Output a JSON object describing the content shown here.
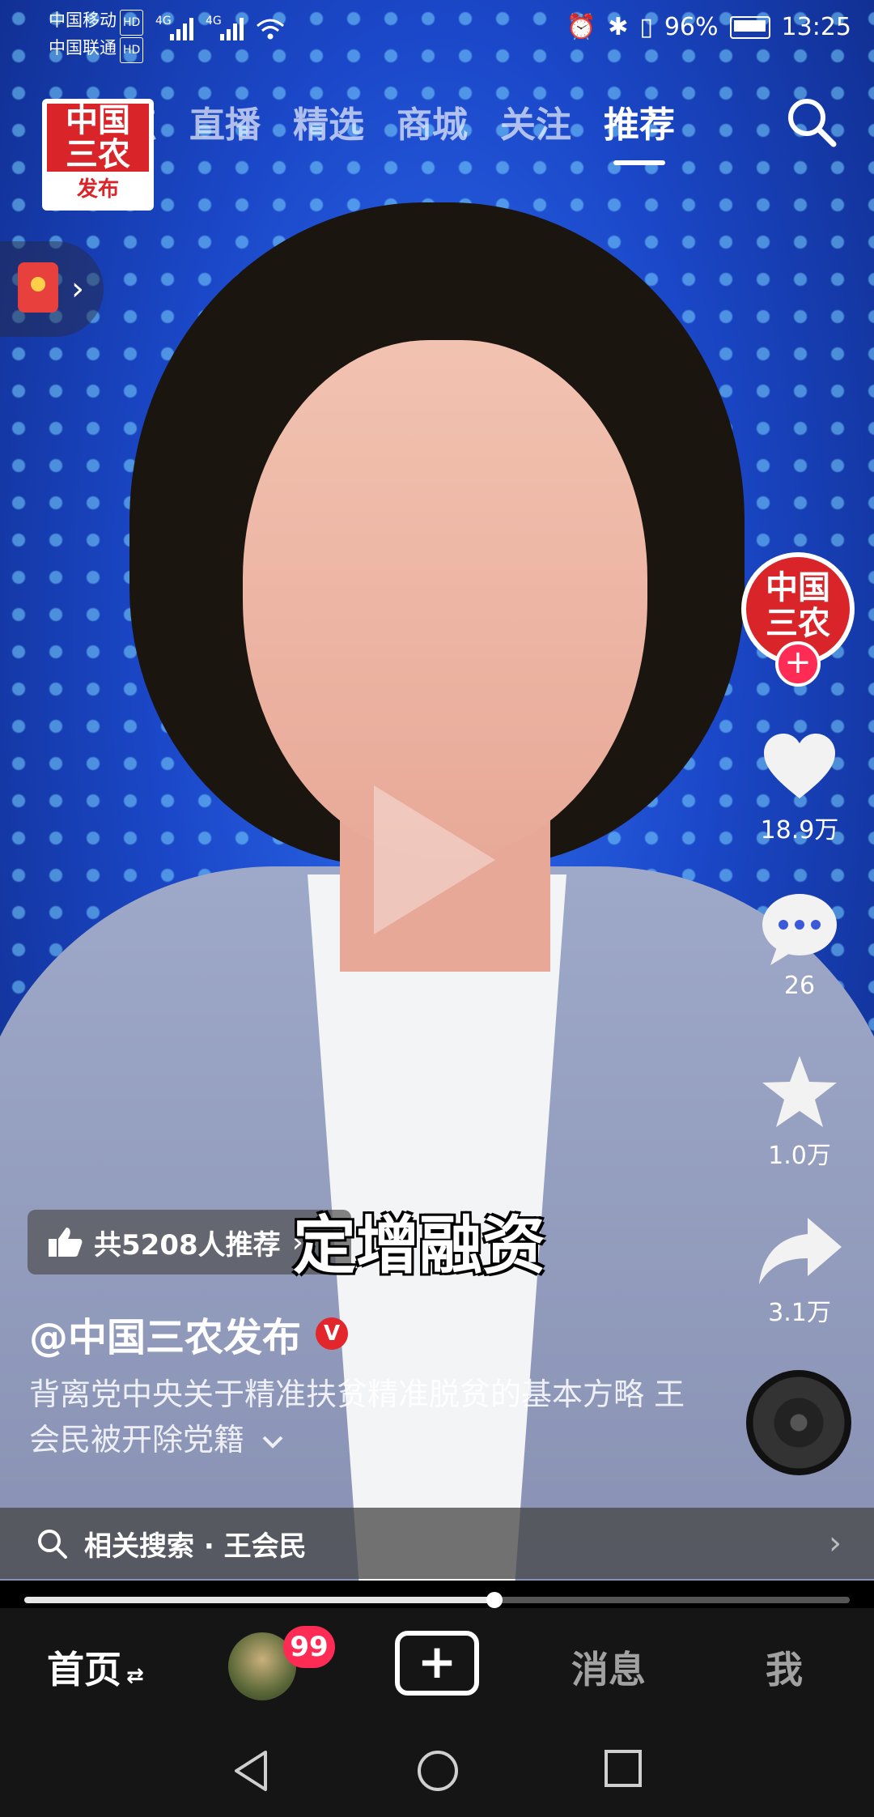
{
  "status_bar": {
    "carrier1": "中国移动",
    "carrier2": "中国联通",
    "hd": "HD",
    "net1": "4G",
    "net2": "4G",
    "battery": "96%",
    "time": "13:25"
  },
  "top_nav": {
    "logo_top": "中国\n三农",
    "logo_bottom": "发布",
    "tabs": [
      "点",
      "直播",
      "精选",
      "商城",
      "关注",
      "推荐"
    ],
    "active_tab": "推荐"
  },
  "video": {
    "burnt_caption": "定增融资",
    "recommend_text": "共5208人推荐",
    "author": "@中国三农发布",
    "verified_badge": "V",
    "description": "背离党中央关于精准扶贫精准脱贫的基本方略 王会民被开除党籍",
    "expand_icon": "chevron-down",
    "progress": 0.57
  },
  "right_rail": {
    "avatar_text": "中国\n三农",
    "follow_symbol": "+",
    "likes": "18.9万",
    "comments": "26",
    "favorites": "1.0万",
    "shares": "3.1万"
  },
  "related_search": {
    "label": "相关搜索 · 王会民"
  },
  "bottom_tabs": {
    "home": "首页",
    "friends_badge": "99",
    "create": "+",
    "messages": "消息",
    "me": "我"
  },
  "colors": {
    "accent": "#fe2c55",
    "brand_red": "#d9252a"
  }
}
